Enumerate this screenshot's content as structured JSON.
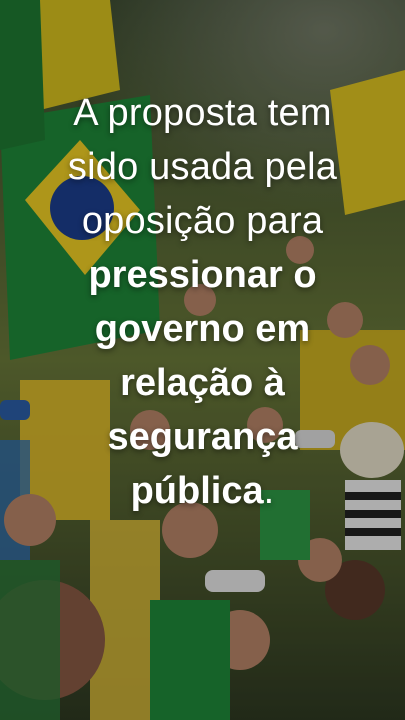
{
  "caption": {
    "light_lines": [
      "A proposta tem",
      "sido usada pela",
      "oposição para"
    ],
    "bold_lines": [
      "pressionar o",
      "governo em",
      "relação à",
      "segurança",
      "pública"
    ],
    "end_punct": "."
  },
  "colors": {
    "flag_green": "#1f8a3a",
    "flag_yellow": "#f2d024",
    "flag_blue": "#1d3f8f",
    "text": "#ffffff"
  }
}
